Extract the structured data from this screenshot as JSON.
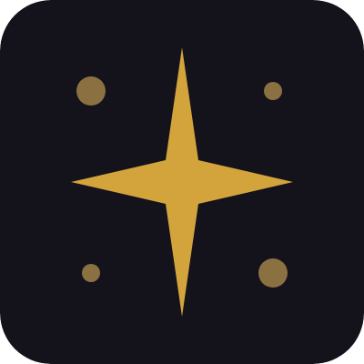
{
  "icon": {
    "name": "sparkle-star-icon",
    "colors": {
      "background": "#14121b",
      "star": "#d3a43c",
      "dots": "#8b7042"
    }
  }
}
